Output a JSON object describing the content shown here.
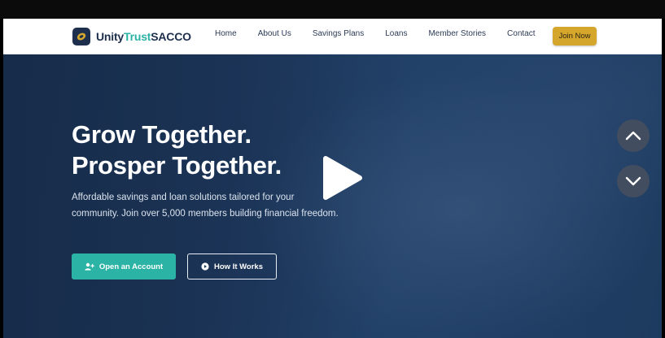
{
  "brand": {
    "name_prefix": "Unity",
    "name_accent": "Trust",
    "name_suffix": "SACCO"
  },
  "nav": {
    "links": [
      "Home",
      "About Us",
      "Savings Plans",
      "Loans",
      "Member Stories",
      "Contact"
    ],
    "cta": "Join Now"
  },
  "hero": {
    "headline_1": "Grow Together.",
    "headline_2": "Prosper Together.",
    "subtext": "Affordable savings and loan solutions tailored for your community. Join over 5,000 members building financial freedom.",
    "primary_button": "Open an Account",
    "secondary_button": "How It Works"
  },
  "icons": {
    "logo": "coin-logo-icon",
    "primary": "user-plus-icon",
    "secondary": "play-circle-icon",
    "video": "play-icon",
    "up": "chevron-up-icon",
    "down": "chevron-down-icon"
  },
  "colors": {
    "brand_navy": "#1d2f4d",
    "brand_teal": "#2bb3a6",
    "cta_gold": "#d4a62c",
    "hero_bg": "#1f3a60"
  }
}
